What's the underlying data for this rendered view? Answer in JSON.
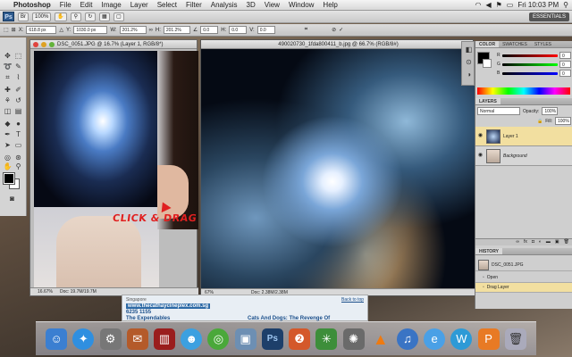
{
  "menubar": {
    "app_name": "Photoshop",
    "items": [
      "File",
      "Edit",
      "Image",
      "Layer",
      "Select",
      "Filter",
      "Analysis",
      "3D",
      "View",
      "Window",
      "Help"
    ],
    "clock": "Fri 10:03 PM"
  },
  "appbar": {
    "logo": "Ps",
    "zoom": "100%",
    "essentials": "ESSENTIALS"
  },
  "options": {
    "x_label": "X:",
    "x_value": "618.8 px",
    "y_label": "Y:",
    "y_value": "1030.0 px",
    "w_label": "W:",
    "w_value": "201.2%",
    "h_label": "H:",
    "h_value": "201.2%",
    "angle_value": "0.0",
    "hskew_label": "H:",
    "hskew_value": "0.0",
    "vskew_label": "V:",
    "vskew_value": "0.0"
  },
  "doc1": {
    "title": "DSC_0051.JPG @ 16.7% (Layer 1, RGB/8*)",
    "zoom": "16.67%",
    "doc_size": "Doc: 19.7M/19.7M"
  },
  "doc2": {
    "title": "490020730_1fda800411_b.jpg @ 66.7% (RGB/8#)",
    "zoom": "67%",
    "doc_size": "Doc: 2.38M/2.38M"
  },
  "annotation": "CLICK & DRAG",
  "color_panel": {
    "tabs": [
      "COLOR",
      "SWATCHES",
      "STYLES"
    ],
    "r_label": "R",
    "g_label": "G",
    "b_label": "B",
    "r_value": "0",
    "g_value": "0",
    "b_value": "0"
  },
  "layers_panel": {
    "tab": "LAYERS",
    "blend_mode": "Normal",
    "opacity_label": "Opacity:",
    "opacity_value": "100%",
    "fill_label": "Fill:",
    "fill_value": "100%",
    "layers": [
      {
        "name": "Layer 1",
        "selected": true
      },
      {
        "name": "Background",
        "selected": false
      }
    ]
  },
  "history_panel": {
    "tab": "HISTORY",
    "snapshot": "DSC_0051.JPG",
    "items": [
      "Open",
      "Drag Layer"
    ]
  },
  "browser_behind": {
    "back_to_top": "Back to top",
    "site": "www.thecathaycineplex.com.sg",
    "country": "Singapore",
    "phone": "6235 1155",
    "movie1": "The Expendables",
    "movie2": "Cats And Dogs: The Revenge Of"
  },
  "dock": {
    "icons": [
      "finder-icon",
      "safari-icon",
      "system-preferences-icon",
      "itunes-gift-icon",
      "photo-booth-icon",
      "messenger-icon",
      "game-icon",
      "preview-icon",
      "photoshop-icon",
      "bittorrent-icon",
      "dashboard-icon",
      "bug-icon",
      "vlc-icon",
      "itunes-icon",
      "ie-icon",
      "wordpress-icon",
      "puzzle-icon",
      "trash-icon"
    ],
    "ps_label": "Ps"
  }
}
